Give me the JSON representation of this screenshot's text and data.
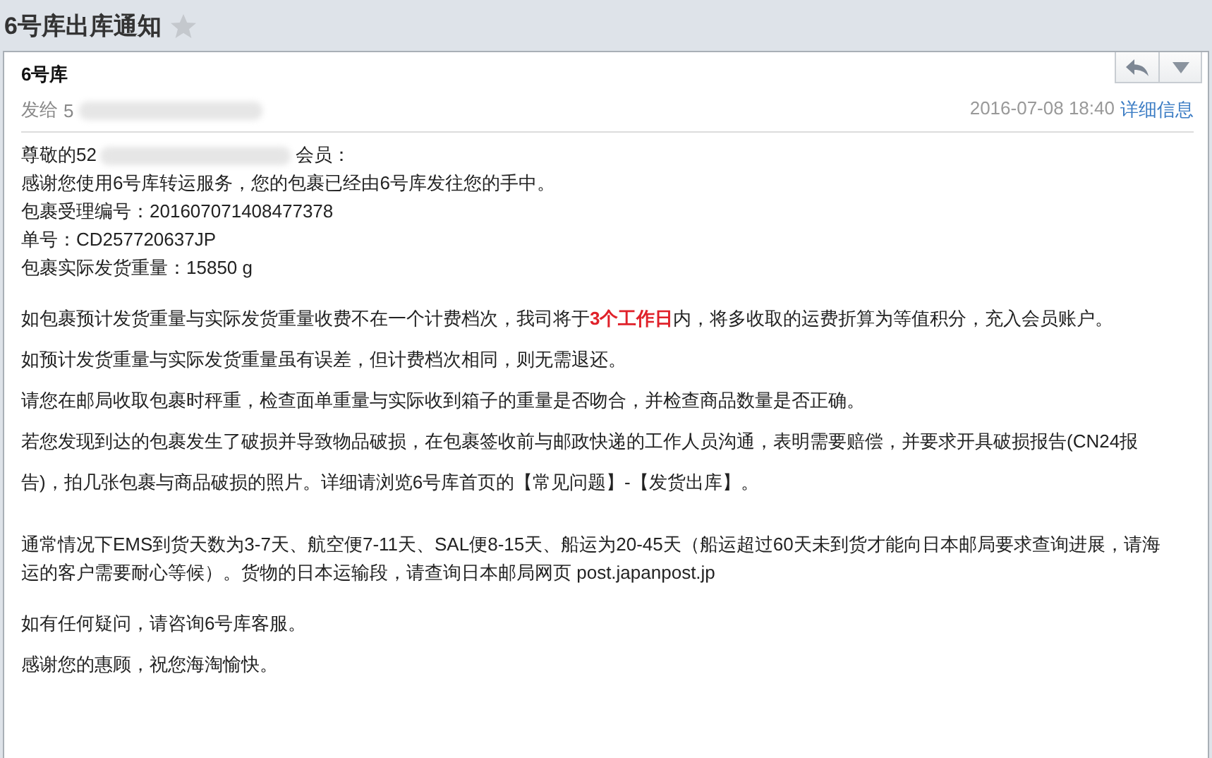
{
  "title": "6号库出库通知",
  "starred": false,
  "sender": "6号库",
  "recipient": {
    "label": "发给",
    "value": "5"
  },
  "date": "2016-07-08 18:40",
  "details_link": "详细信息",
  "body": [
    {
      "kind": "tight",
      "lines": [
        {
          "kind": "greeting",
          "prefix": "尊敬的52",
          "suffix": "会员："
        },
        {
          "kind": "text",
          "text": "感谢您使用6号库转运服务，您的包裹已经由6号库发往您的手中。"
        },
        {
          "kind": "text",
          "text": "包裹受理编号：201607071408477378"
        },
        {
          "kind": "text",
          "text": "单号：CD257720637JP"
        },
        {
          "kind": "text",
          "text": "包裹实际发货重量：15850 g"
        }
      ]
    },
    {
      "kind": "loose",
      "lines": [
        {
          "kind": "text",
          "text": "如包裹预计发货重量与实际发货重量收费不在一个计费档次，我司将于**3个工作日**内，将多收取的运费折算为等值积分，充入会员账户。"
        },
        {
          "kind": "text",
          "text": "如预计发货重量与实际发货重量虽有误差，但计费档次相同，则无需退还。"
        },
        {
          "kind": "text",
          "text": "请您在邮局收取包裹时秤重，检查面单重量与实际收到箱子的重量是否吻合，并检查商品数量是否正确。"
        },
        {
          "kind": "text",
          "text": "若您发现到达的包裹发生了破损并导致物品破损，在包裹签收前与邮政快递的工作人员沟通，表明需要赔偿，并要求开具破损报告(CN24报告)，拍几张包裹与商品破损的照片。详细请浏览6号库首页的【常见问题】-【发货出库】。"
        }
      ]
    },
    {
      "kind": "tight",
      "lines": [
        {
          "kind": "text",
          "text": "通常情况下EMS到货天数为3-7天、航空便7-11天、SAL便8-15天、船运为20-45天（船运超过60天未到货才能向日本邮局要求查询进展，请海运的客户需要耐心等候）。货物的日本运输段，请查询日本邮局网页 post.japanpost.jp"
        }
      ]
    },
    {
      "kind": "loose",
      "lines": [
        {
          "kind": "text",
          "text": "如有任何疑问，请咨询6号库客服。"
        },
        {
          "kind": "text",
          "text": "感谢您的惠顾，祝您海淘愉快。"
        }
      ]
    }
  ]
}
